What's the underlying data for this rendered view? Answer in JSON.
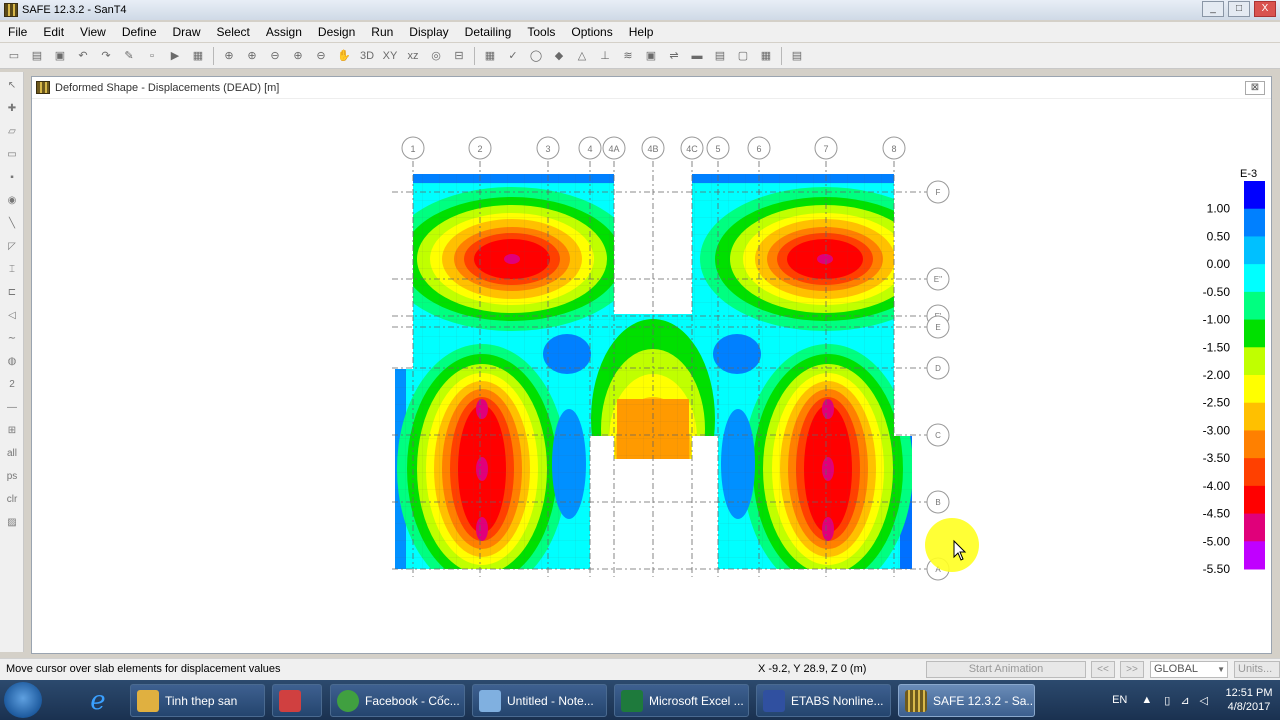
{
  "window": {
    "title": "SAFE 12.3.2 - SanT4",
    "min": "_",
    "max": "□",
    "close": "X"
  },
  "menu": [
    "File",
    "Edit",
    "View",
    "Define",
    "Draw",
    "Select",
    "Assign",
    "Design",
    "Run",
    "Display",
    "Detailing",
    "Tools",
    "Options",
    "Help"
  ],
  "toolbar_text": {
    "threed": "3D",
    "xy": "XY",
    "xz": "xz"
  },
  "left_tools": {
    "all": "all",
    "ps": "ps",
    "clr": "clr",
    "two": "2"
  },
  "canvas": {
    "title": "Deformed Shape - Displacements (DEAD)  [m]",
    "close": "⊠"
  },
  "grid": {
    "x_labels": [
      "1",
      "2",
      "3",
      "4",
      "4A",
      "4B",
      "4C",
      "5",
      "6",
      "7",
      "8"
    ],
    "y_labels": [
      "F",
      "E''",
      "E'",
      "E",
      "D",
      "C",
      "B",
      "A"
    ]
  },
  "legend": {
    "exponent": "E-3",
    "labels": [
      "1.00",
      "0.50",
      "0.00",
      "-0.50",
      "-1.00",
      "-1.50",
      "-2.00",
      "-2.50",
      "-3.00",
      "-3.50",
      "-4.00",
      "-4.50",
      "-5.00",
      "-5.50"
    ],
    "colors": [
      "#0000ff",
      "#0080ff",
      "#00c0ff",
      "#00ffff",
      "#00ff80",
      "#00e000",
      "#c0ff00",
      "#ffff00",
      "#ffc000",
      "#ff8000",
      "#ff4000",
      "#ff0000",
      "#e0007a",
      "#c000ff"
    ]
  },
  "status": {
    "message": "Move cursor over slab elements for displacement values",
    "coords": "X -9.2,  Y 28.9,  Z 0  (m)",
    "animation": "Start Animation",
    "prev": "<<",
    "next": ">>",
    "coord_system": "GLOBAL",
    "units": "Units..."
  },
  "taskbar": {
    "apps": [
      {
        "label": "Tinh thep san",
        "color": "#e0b040"
      },
      {
        "label": "",
        "color": "#d04040"
      },
      {
        "label": "Facebook - Cốc...",
        "color": "#40a040"
      },
      {
        "label": "Untitled - Note...",
        "color": "#80b0e0"
      },
      {
        "label": "Microsoft Excel ...",
        "color": "#1e7a3c"
      },
      {
        "label": "ETABS Nonline...",
        "color": "#3050a0"
      },
      {
        "label": "SAFE 12.3.2 - Sa...",
        "color": "#c8a040"
      }
    ],
    "lang": "EN",
    "time": "12:51 PM",
    "date": "4/8/2017"
  }
}
